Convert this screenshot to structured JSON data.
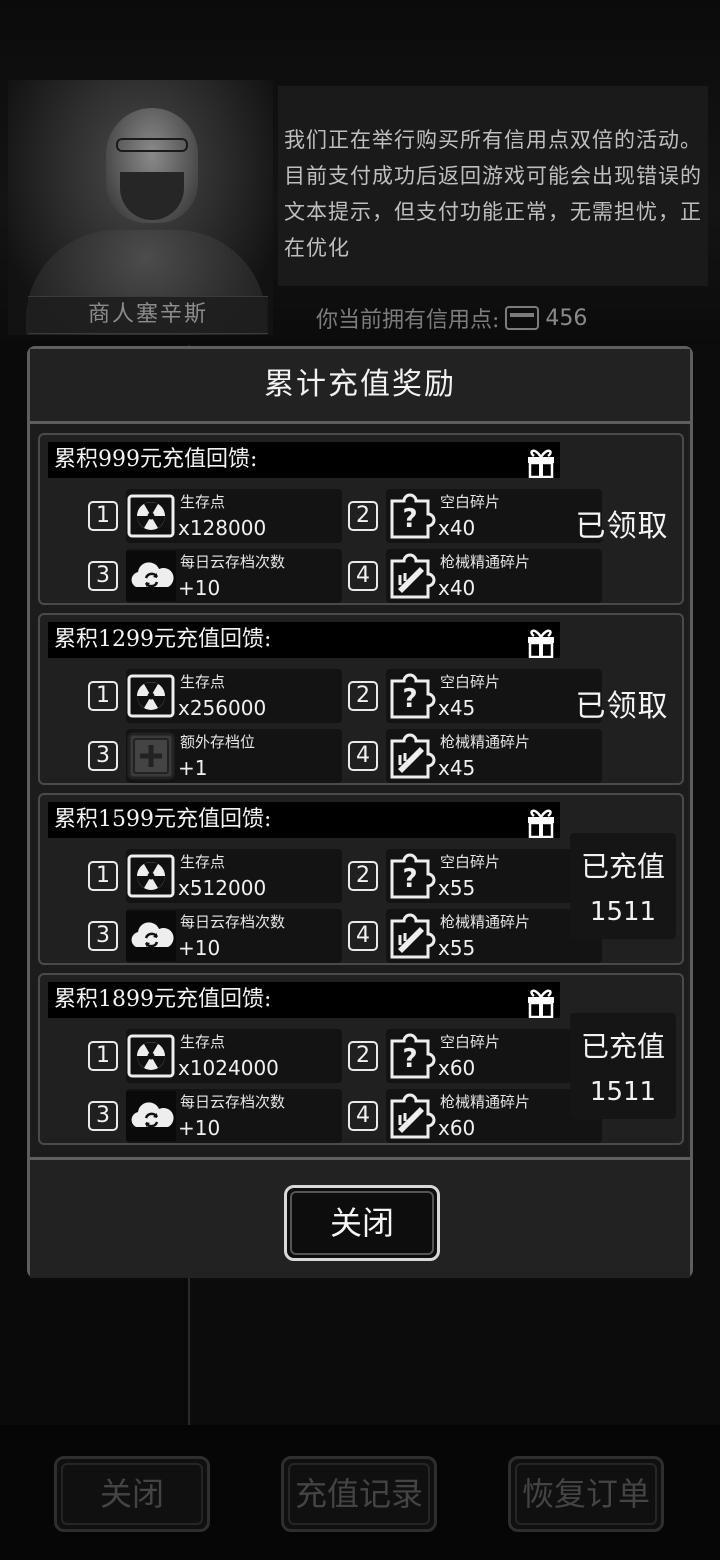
{
  "merchant": {
    "name": "商人塞辛斯",
    "message": "我们正在举行购买所有信用点双倍的活动。目前支付成功后返回游戏可能会出现错误的文本提示，但支付功能正常，无需担忧，正在优化",
    "credits_label": "你当前拥有信用点:",
    "credits_value": "456"
  },
  "dialog": {
    "title": "累计充值奖励",
    "close_label": "关闭",
    "tiers": [
      {
        "header": "累积999元充值回馈:",
        "status": "已领取",
        "items": [
          {
            "index": "1",
            "name": "生存点",
            "qty": "x128000",
            "icon": "radiation-icon"
          },
          {
            "index": "2",
            "name": "空白碎片",
            "qty": "x40",
            "icon": "puzzle-question-icon"
          },
          {
            "index": "3",
            "name": "每日云存档次数",
            "qty": "+10",
            "icon": "cloud-sync-icon"
          },
          {
            "index": "4",
            "name": "枪械精通碎片",
            "qty": "x40",
            "icon": "puzzle-gun-icon"
          }
        ]
      },
      {
        "header": "累积1299元充值回馈:",
        "status": "已领取",
        "items": [
          {
            "index": "1",
            "name": "生存点",
            "qty": "x256000",
            "icon": "radiation-icon"
          },
          {
            "index": "2",
            "name": "空白碎片",
            "qty": "x45",
            "icon": "puzzle-question-icon"
          },
          {
            "index": "3",
            "name": "额外存档位",
            "qty": "+1",
            "icon": "plus-slot-icon"
          },
          {
            "index": "4",
            "name": "枪械精通碎片",
            "qty": "x45",
            "icon": "puzzle-gun-icon"
          }
        ]
      },
      {
        "header": "累积1599元充值回馈:",
        "progress_label": "已充值",
        "progress_value": "1511",
        "items": [
          {
            "index": "1",
            "name": "生存点",
            "qty": "x512000",
            "icon": "radiation-icon"
          },
          {
            "index": "2",
            "name": "空白碎片",
            "qty": "x55",
            "icon": "puzzle-question-icon"
          },
          {
            "index": "3",
            "name": "每日云存档次数",
            "qty": "+10",
            "icon": "cloud-sync-icon"
          },
          {
            "index": "4",
            "name": "枪械精通碎片",
            "qty": "x55",
            "icon": "puzzle-gun-icon"
          }
        ]
      },
      {
        "header": "累积1899元充值回馈:",
        "progress_label": "已充值",
        "progress_value": "1511",
        "items": [
          {
            "index": "1",
            "name": "生存点",
            "qty": "x1024000",
            "icon": "radiation-icon"
          },
          {
            "index": "2",
            "name": "空白碎片",
            "qty": "x60",
            "icon": "puzzle-question-icon"
          },
          {
            "index": "3",
            "name": "每日云存档次数",
            "qty": "+10",
            "icon": "cloud-sync-icon"
          },
          {
            "index": "4",
            "name": "枪械精通碎片",
            "qty": "x60",
            "icon": "puzzle-gun-icon"
          }
        ]
      }
    ]
  },
  "bottom_buttons": {
    "close": "关闭",
    "history": "充值记录",
    "restore": "恢复订单"
  }
}
